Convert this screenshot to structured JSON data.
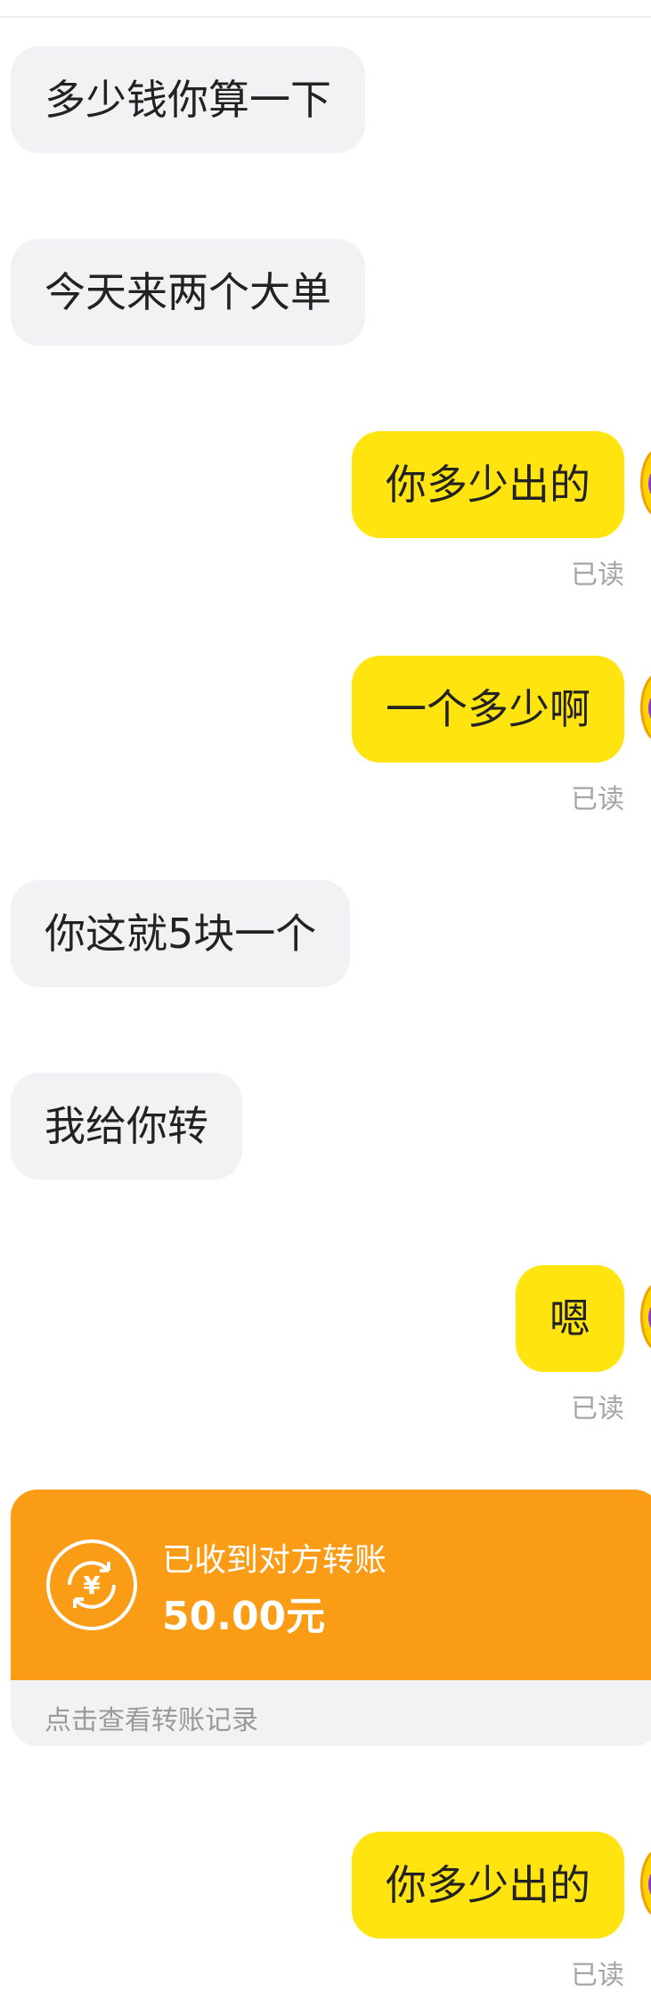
{
  "messages": [
    {
      "text": "多少钱你算一下"
    },
    {
      "text": "今天来两个大单"
    },
    {
      "text": "你多少出的",
      "status": "已读"
    },
    {
      "text": "一个多少啊",
      "status": "已读"
    },
    {
      "text": "你这就5块一个"
    },
    {
      "text": "我给你转"
    },
    {
      "text": "嗯",
      "status": "已读"
    },
    {
      "text": "你多少出的",
      "status": "已读"
    }
  ],
  "transfer": {
    "title": "已收到对方转账",
    "amount": "50.00元",
    "footer": "点击查看转账记录",
    "icon": "yuan-exchange-icon"
  },
  "colors": {
    "outgoing_bubble": "#ffe410",
    "incoming_bubble": "#f2f2f4",
    "transfer_card": "#fb9c16",
    "read_status": "#a5a5a5"
  }
}
